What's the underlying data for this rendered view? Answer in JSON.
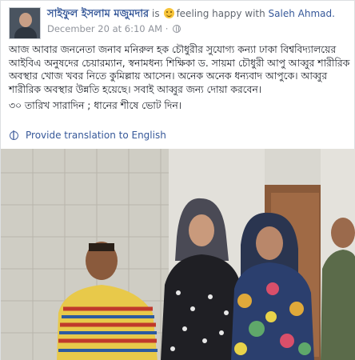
{
  "post": {
    "author": "সাইফুল ইসলাম মজুমদার",
    "is_text": "is",
    "feeling_text": "feeling happy with",
    "tagged_friend": "Saleh Ahmad.",
    "timestamp": "December 20 at 6:10 AM",
    "separator": "·",
    "paragraph1": "আজ আবার জননেতা জনাব মনিরুল হক চৌধুরীর সুযোগ্য কন্যা ঢাকা বিশ্ববিদ্যালয়ের আইবিএ অনুষদের চেয়ারম্যান, স্বনামধন্য শিক্ষিকা ড. সায়মা চৌধুরী আপু আব্বুর শারীরিক অবস্থার খোজ খবর নিতে কুমিল্লায় আসেন। অনেক অনেক ধন্যবাদ আপুকে। আব্বুর শারীরিক অবস্থার উন্নতি হয়েছে। সবাই আব্বুর জন্য দোয়া করবেন।",
    "paragraph2": "৩০ তারিখ সারাদিন ; ধানের শীষে ভোট দিন।",
    "translate_label": "Provide translation to English"
  },
  "icons": {
    "feeling": "smiley-face-icon",
    "audience": "globe-icon",
    "translate": "globe-translate-icon"
  },
  "colors": {
    "link": "#365899",
    "meta": "#90949c",
    "text": "#1d2129"
  }
}
